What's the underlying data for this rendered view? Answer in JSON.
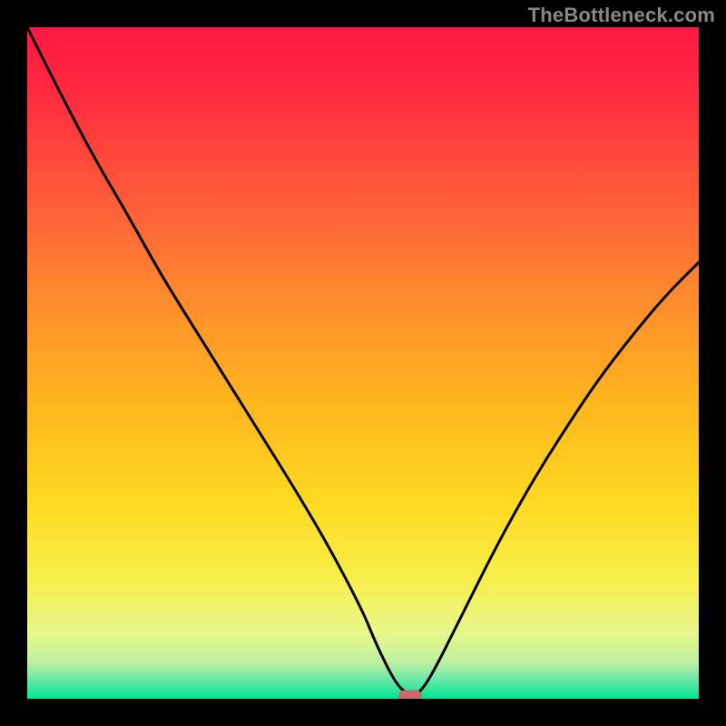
{
  "watermark": "TheBottleneck.com",
  "chart_data": {
    "type": "line",
    "title": "",
    "xlabel": "",
    "ylabel": "",
    "xlim": [
      0,
      100
    ],
    "ylim": [
      0,
      100
    ],
    "grid": false,
    "series": [
      {
        "name": "curve",
        "x": [
          0,
          5,
          10,
          15,
          20,
          25,
          30,
          35,
          40,
          45,
          50,
          52,
          55,
          57,
          58,
          60,
          65,
          70,
          75,
          80,
          85,
          90,
          95,
          100
        ],
        "y": [
          100,
          90,
          80.5,
          72,
          63,
          55,
          47,
          39,
          31,
          22.5,
          13,
          8,
          2,
          0.5,
          0.5,
          3,
          13,
          23,
          32,
          40,
          47.5,
          54,
          60,
          65
        ]
      }
    ],
    "marker": {
      "x": 57,
      "y": 0.5,
      "color": "#c86a6a",
      "width": 3.5,
      "height": 1.6,
      "rx": 1.0
    },
    "background": {
      "type": "vertical-gradient",
      "stops": [
        {
          "offset": 0.0,
          "color": "#ff1744"
        },
        {
          "offset": 0.1,
          "color": "#ff2b3e"
        },
        {
          "offset": 0.25,
          "color": "#ff593a"
        },
        {
          "offset": 0.4,
          "color": "#ff8a2e"
        },
        {
          "offset": 0.55,
          "color": "#ffb31f"
        },
        {
          "offset": 0.7,
          "color": "#ffd820"
        },
        {
          "offset": 0.82,
          "color": "#f7ee4a"
        },
        {
          "offset": 0.9,
          "color": "#e8f78a"
        },
        {
          "offset": 0.945,
          "color": "#c0f0a0"
        },
        {
          "offset": 0.97,
          "color": "#70e8a8"
        },
        {
          "offset": 1.0,
          "color": "#00e492"
        }
      ]
    }
  }
}
